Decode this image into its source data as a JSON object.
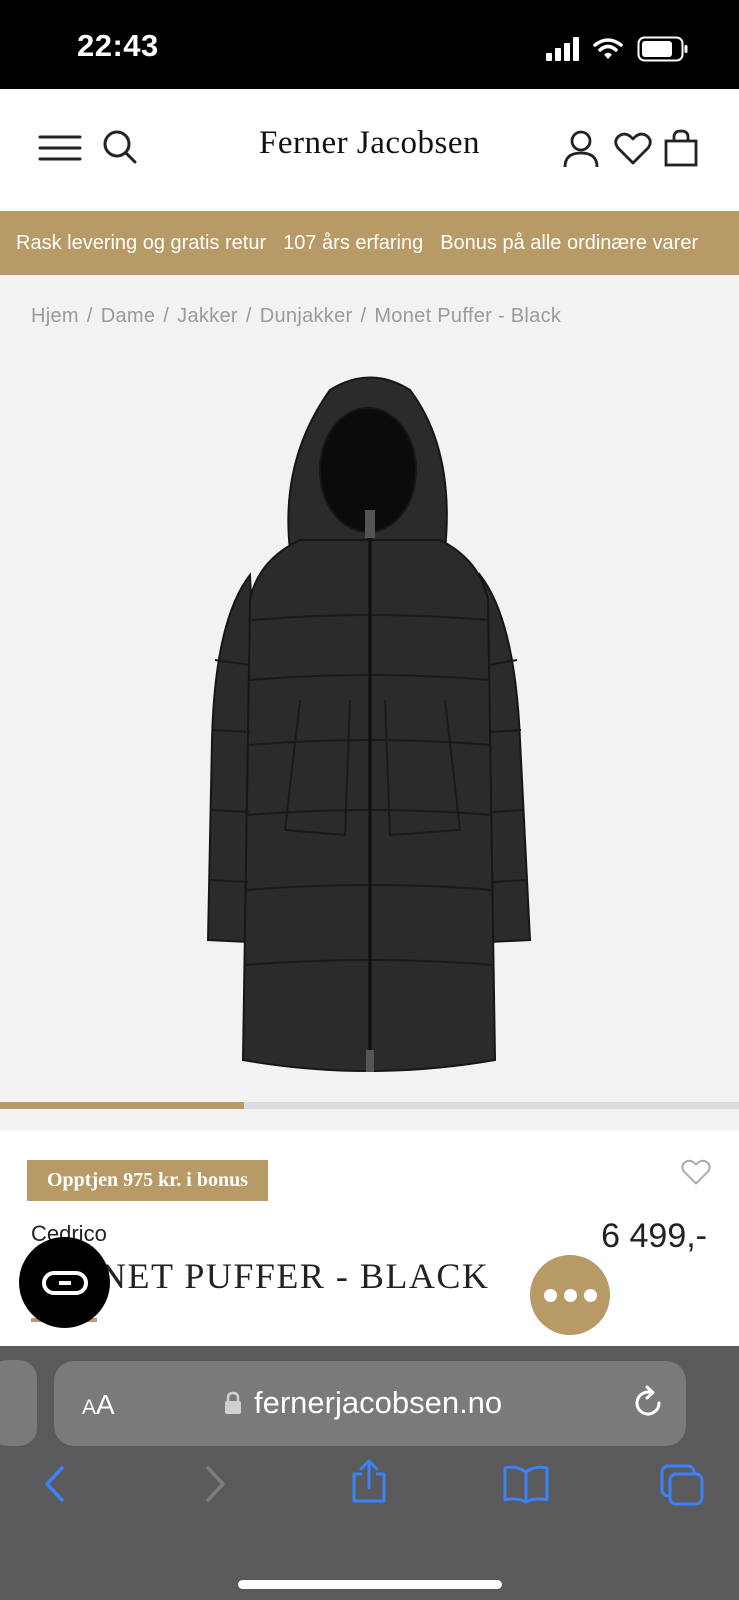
{
  "status_bar": {
    "time": "22:43"
  },
  "header": {
    "logo": "Ferner Jacobsen"
  },
  "promo": {
    "items": [
      "Rask levering og gratis retur",
      "107 års erfaring",
      "Bonus på alle ordinære varer"
    ]
  },
  "breadcrumb": {
    "items": [
      "Hjem",
      "Dame",
      "Jakker",
      "Dunjakker",
      "Monet Puffer - Black"
    ]
  },
  "gallery": {
    "progress": 0.33
  },
  "product": {
    "bonus_badge": "Opptjen 975 kr. i bonus",
    "brand": "Cedrico",
    "title": "NET PUFFER - BLACK",
    "price": "6 499,-"
  },
  "browser": {
    "url": "fernerjacobsen.no",
    "text_size_big": "A",
    "text_size_small": "A"
  },
  "colors": {
    "accent": "#b89a67",
    "browser_bar": "#5a5a5c",
    "browser_icon": "#3b82f6"
  }
}
